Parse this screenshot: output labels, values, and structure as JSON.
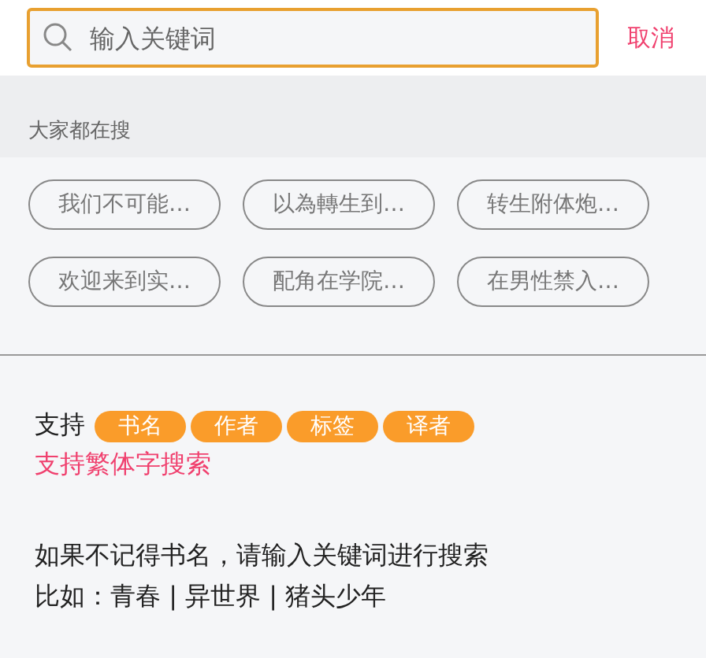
{
  "search": {
    "placeholder": "输入关键词"
  },
  "cancel": "取消",
  "hot_title": "大家都在搜",
  "hot_tags": [
    "我们不可能…",
    "以為轉生到…",
    "转生附体炮…",
    "欢迎来到实…",
    "配角在学院…",
    "在男性禁入…"
  ],
  "support": {
    "label": "支持",
    "badges": [
      "书名",
      "作者",
      "标签",
      "译者"
    ],
    "note": "支持繁体字搜索"
  },
  "hint": [
    "如果不记得书名，请输入关键词进行搜索",
    "比如：青春 | 异世界 | 猪头少年"
  ]
}
